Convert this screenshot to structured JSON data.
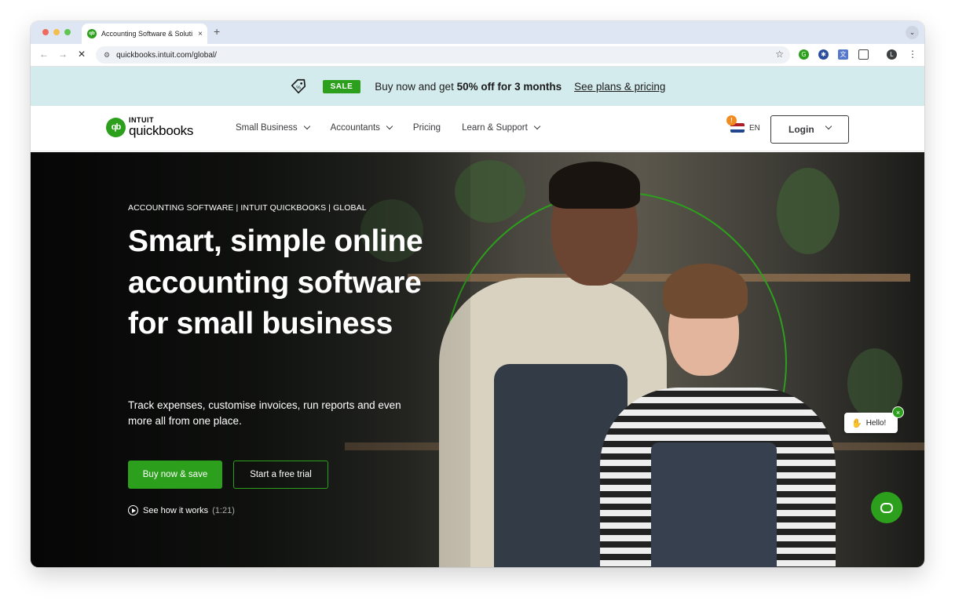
{
  "browser": {
    "tab_title": "Accounting Software & Soluti",
    "tab_close": "×",
    "new_tab": "+",
    "tab_menu": "⌄",
    "url": "quickbooks.intuit.com/global/",
    "nav_icons": [
      "back-icon",
      "forward-icon",
      "stop-icon"
    ],
    "avatar": "L"
  },
  "promo": {
    "badge": "SALE",
    "text_prefix": "Buy now and get ",
    "text_bold": "50% off for 3 months",
    "link": "See plans & pricing"
  },
  "header": {
    "logo_intuit": "INTUIT",
    "logo_product": "quickbooks",
    "logo_mark": "qb",
    "nav": [
      {
        "label": "Small Business",
        "dropdown": true
      },
      {
        "label": "Accountants",
        "dropdown": true
      },
      {
        "label": "Pricing",
        "dropdown": false
      },
      {
        "label": "Learn & Support",
        "dropdown": true
      }
    ],
    "language": "EN",
    "notification_badge": "!",
    "login": "Login"
  },
  "hero": {
    "eyebrow": "ACCOUNTING SOFTWARE | INTUIT QUICKBOOKS | GLOBAL",
    "headline": "Smart, simple online accounting software for small business",
    "subtext": "Track expenses, customise invoices, run reports and even more all from one place.",
    "primary_cta": "Buy now & save",
    "secondary_cta": "Start a free trial",
    "video_link": "See how it works",
    "video_duration": "(1:21)"
  },
  "chat": {
    "greeting": "Hello!",
    "close": "×"
  },
  "colors": {
    "brand_green": "#2ca01c",
    "promo_bg": "#d4ebee",
    "text_dark": "#393a3d"
  }
}
